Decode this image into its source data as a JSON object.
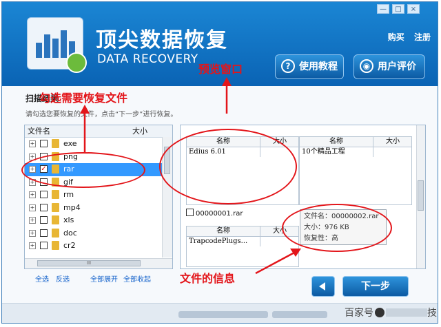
{
  "window": {
    "min_glyph": "—",
    "max_glyph": "□",
    "close_glyph": "×"
  },
  "header": {
    "title_cn": "顶尖数据恢复",
    "title_en": "DATA RECOVERY",
    "link_buy": "购买",
    "link_register": "注册",
    "btn_tutorial": "使用教程",
    "btn_review": "用户评价",
    "tutorial_icon_glyph": "?",
    "review_icon_glyph": "◉"
  },
  "annotations": {
    "select_files": "勾选需要恢复文件",
    "preview_window": "预览窗口",
    "file_info": "文件的信息"
  },
  "left": {
    "scan_label": "扫描结果",
    "instruction": "请勾选您要恢复的文件，点击“下一步”进行恢复。",
    "col_name": "文件名",
    "col_size": "大小",
    "rows": [
      {
        "label": "exe",
        "expander": "+",
        "checkmark": ""
      },
      {
        "label": "png",
        "expander": "+",
        "checkmark": ""
      },
      {
        "label": "rar",
        "expander": "+",
        "checkmark": "✓"
      },
      {
        "label": "gif",
        "expander": "+",
        "checkmark": ""
      },
      {
        "label": "rm",
        "expander": "+",
        "checkmark": ""
      },
      {
        "label": "mp4",
        "expander": "+",
        "checkmark": ""
      },
      {
        "label": "xls",
        "expander": "+",
        "checkmark": ""
      },
      {
        "label": "doc",
        "expander": "+",
        "checkmark": ""
      },
      {
        "label": "cr2",
        "expander": "+",
        "checkmark": ""
      }
    ],
    "hscroll_grip": "III",
    "link_select_all": "全选",
    "link_invert": "反选",
    "link_expand_all": "全部展开",
    "link_collapse_all": "全部收起"
  },
  "preview": {
    "col_name": "名称",
    "col_size": "大小",
    "tile1_row": "Edius 6.01",
    "tile2_row": "10个精品工程",
    "tile3_row": "TrapcodePlugs...",
    "item_label": "00000001.rar",
    "tip_line1": "文件名：00000002.rar",
    "tip_line2": "大小：976 KB",
    "tip_line3": "恢复性：高"
  },
  "footer": {
    "next_label": "下一步",
    "watermark_left": "百家号",
    "watermark_right": "技"
  },
  "colors": {
    "header_blue": "#0a63b4",
    "annotation_red": "#e3151a",
    "selection_blue": "#3399ff",
    "folder_yellow": "#e8b634"
  }
}
